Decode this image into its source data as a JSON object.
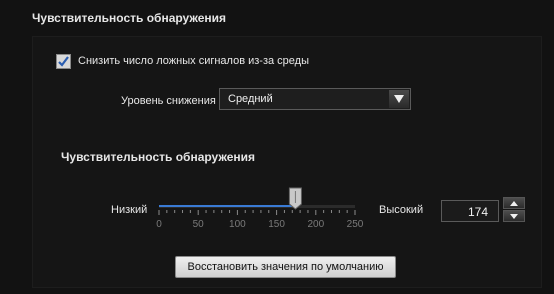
{
  "panel": {
    "title": "Чувствительность обнаружения",
    "reduce_false_alarms": {
      "label": "Снизить число ложных сигналов из-за среды",
      "checked": true
    },
    "reduction_level": {
      "label": "Уровень снижения",
      "value": "Средний"
    },
    "sensitivity": {
      "title": "Чувствительность обнаружения",
      "low_label": "Низкий",
      "high_label": "Высокий",
      "value": "174",
      "slider_value": 174,
      "min": 0,
      "max": 250,
      "ticks": [
        "0",
        "50",
        "100",
        "150",
        "200",
        "250"
      ]
    },
    "reset_button": "Восстановить значения по умолчанию"
  },
  "colors": {
    "background": "#121212",
    "slider_fill": "#3a7bd5",
    "button": "#e0e0e0"
  },
  "icons": {
    "checkbox": "checkmark-icon",
    "dropdown": "triangle-down-icon",
    "spin_up": "triangle-up-icon",
    "spin_down": "triangle-down-icon"
  }
}
